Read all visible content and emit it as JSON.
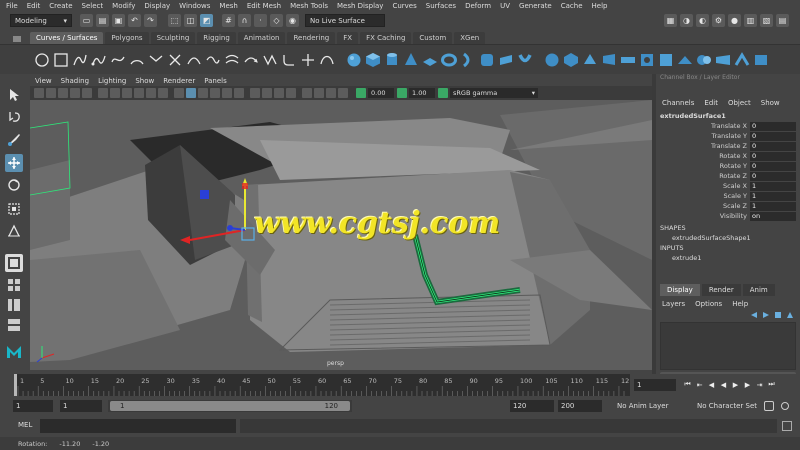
{
  "menubar": [
    "File",
    "Edit",
    "Create",
    "Select",
    "Modify",
    "Display",
    "Windows",
    "Mesh",
    "Edit Mesh",
    "Mesh Tools",
    "Mesh Display",
    "Curves",
    "Surfaces",
    "Deform",
    "UV",
    "Generate",
    "Cache",
    "Help"
  ],
  "statusline": {
    "mode": "Modeling",
    "live_surface": "No Live Surface"
  },
  "shelf_tabs": [
    "Curves / Surfaces",
    "Polygons",
    "Sculpting",
    "Rigging",
    "Animation",
    "Rendering",
    "FX",
    "FX Caching",
    "Custom",
    "XGen"
  ],
  "shelf_active_tab": "Curves / Surfaces",
  "panel_menu": [
    "View",
    "Shading",
    "Lighting",
    "Show",
    "Renderer",
    "Panels"
  ],
  "panel_toolbar": {
    "exposure": "0.00",
    "gamma": "1.00",
    "color_space": "sRGB gamma"
  },
  "viewport": {
    "camera_label": "persp",
    "watermark": "www.cgtsj.com"
  },
  "channel_box": {
    "title": "Channel Box / Layer Editor",
    "menu": [
      "Channels",
      "Edit",
      "Object",
      "Show"
    ],
    "object_name": "extrudedSurface1",
    "attributes": [
      {
        "name": "Translate X",
        "value": "0"
      },
      {
        "name": "Translate Y",
        "value": "0"
      },
      {
        "name": "Translate Z",
        "value": "0"
      },
      {
        "name": "Rotate X",
        "value": "0"
      },
      {
        "name": "Rotate Y",
        "value": "0"
      },
      {
        "name": "Rotate Z",
        "value": "0"
      },
      {
        "name": "Scale X",
        "value": "1"
      },
      {
        "name": "Scale Y",
        "value": "1"
      },
      {
        "name": "Scale Z",
        "value": "1"
      },
      {
        "name": "Visibility",
        "value": "on"
      }
    ],
    "shapes_header": "SHAPES",
    "shape_name": "extrudedSurfaceShape1",
    "inputs_header": "INPUTS",
    "input_name": "extrude1"
  },
  "layer_editor": {
    "tabs": [
      "Display",
      "Render",
      "Anim"
    ],
    "active_tab": "Display",
    "menu": [
      "Layers",
      "Options",
      "Help"
    ]
  },
  "time_slider": {
    "ticks": [
      "1",
      "5",
      "10",
      "15",
      "20",
      "25",
      "30",
      "35",
      "40",
      "45",
      "50",
      "55",
      "60",
      "65",
      "70",
      "75",
      "80",
      "85",
      "90",
      "95",
      "100",
      "105",
      "110",
      "115",
      "12"
    ],
    "current_frame": "1"
  },
  "range_slider": {
    "start": "1",
    "playback_start": "1",
    "range_start_label": "1",
    "range_end_label": "120",
    "playback_end": "120",
    "end": "200",
    "anim_layer": "No Anim Layer",
    "character_set": "No Character Set"
  },
  "command_line": {
    "label": "MEL"
  },
  "help_line": {
    "label": "Rotation:",
    "value1": "-11.20",
    "value2": "-1.20"
  },
  "colors": {
    "selection_blue": "#5b8fb0",
    "watermark": "#f2e526",
    "curve_green": "#2ee87a"
  }
}
